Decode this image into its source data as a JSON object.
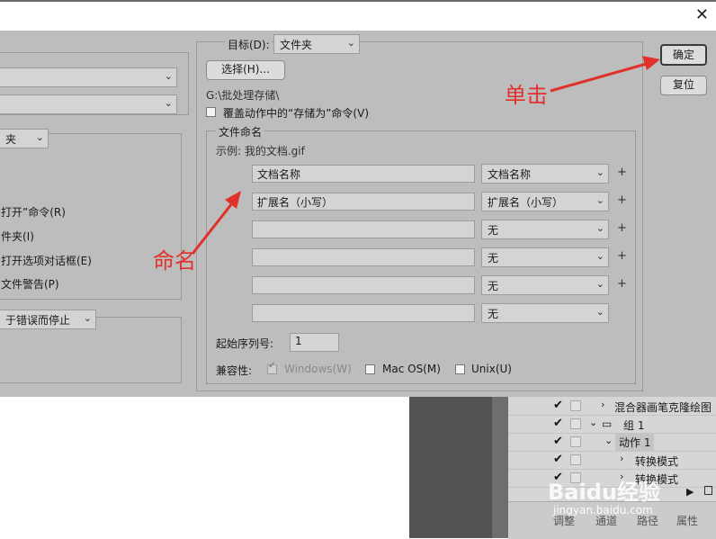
{
  "title_bar": {
    "close_icon": "close-icon"
  },
  "left_panel": {
    "set_select": "",
    "action_select": "",
    "source_select": "夹",
    "lines": [
      "打开”命令(R)",
      "件夹(I)",
      "打开选项对话框(E)",
      "文件警告(P)"
    ],
    "errors_select": "于错误而停止"
  },
  "destination": {
    "label": "目标(D):",
    "select": "文件夹",
    "choose_button": "选择(H)...",
    "path": "G:\\批处理存储\\",
    "override_label": "覆盖动作中的“存储为”命令(V)"
  },
  "file_naming": {
    "legend": "文件命名",
    "example": "示例: 我的文档.gif",
    "rows": [
      {
        "field": "文档名称",
        "select": "文档名称",
        "plus": "+"
      },
      {
        "field": "扩展名（小写）",
        "select": "扩展名（小写）",
        "plus": "+"
      },
      {
        "field": "",
        "select": "无",
        "plus": "+"
      },
      {
        "field": "",
        "select": "无",
        "plus": "+"
      },
      {
        "field": "",
        "select": "无",
        "plus": "+"
      },
      {
        "field": "",
        "select": "无",
        "plus": ""
      }
    ],
    "serial_label": "起始序列号:",
    "serial_value": "1",
    "compat_label": "兼容性:",
    "compat_windows": "Windows(W)",
    "compat_mac": "Mac OS(M)",
    "compat_unix": "Unix(U)"
  },
  "buttons": {
    "ok": "确定",
    "reset": "复位"
  },
  "annotations": {
    "click": "单击",
    "rename": "命名"
  },
  "ps_panel": {
    "rows": [
      "混合器画笔克隆绘图",
      "组 1",
      "动作 1",
      "转换模式",
      "转换模式"
    ],
    "tabs": [
      "调整",
      "通道",
      "路径",
      "属性"
    ],
    "watermark": "Baidu经验",
    "watermark_url": "jingyan.baidu.com"
  },
  "colors": {
    "annotation": "#e0312b",
    "dialog_bg": "#bdbdbd"
  }
}
